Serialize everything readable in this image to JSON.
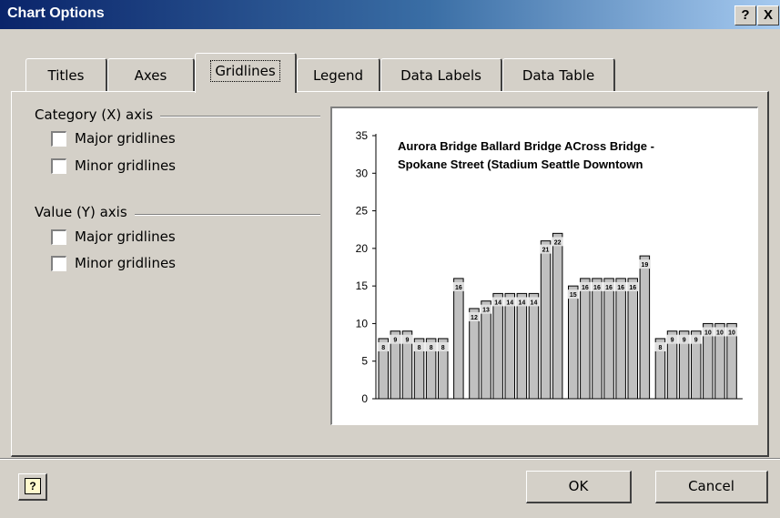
{
  "window": {
    "title": "Chart Options",
    "help_button": "?",
    "close_button": "X"
  },
  "tabs": [
    {
      "label": "Titles",
      "active": false
    },
    {
      "label": "Axes",
      "active": false
    },
    {
      "label": "Gridlines",
      "active": true
    },
    {
      "label": "Legend",
      "active": false
    },
    {
      "label": "Data Labels",
      "active": false
    },
    {
      "label": "Data Table",
      "active": false
    }
  ],
  "gridlines": {
    "category_group": {
      "title": "Category (X) axis",
      "major_label": "Major gridlines",
      "major_checked": false,
      "minor_label": "Minor gridlines",
      "minor_checked": false
    },
    "value_group": {
      "title": "Value (Y) axis",
      "major_label": "Major gridlines",
      "major_checked": false,
      "minor_label": "Minor gridlines",
      "minor_checked": false
    }
  },
  "buttons": {
    "ok": "OK",
    "cancel": "Cancel",
    "help_icon": "help-question-icon"
  },
  "chart_data": {
    "type": "bar",
    "title_lines": [
      "Aurora Bridge Ballard Bridge ACross Bridge -",
      "Spokane Street (Stadium Seattle Downtown"
    ],
    "ylim": [
      0,
      35
    ],
    "yticks": [
      0,
      5,
      10,
      15,
      20,
      25,
      30,
      35
    ],
    "grid": false,
    "bar_color": "#c0c0c0",
    "groups": [
      {
        "values": [
          8,
          9,
          9,
          8,
          8,
          8
        ]
      },
      {
        "values": [
          16
        ]
      },
      {
        "values": [
          12,
          13,
          14,
          14,
          14,
          14,
          21,
          22
        ]
      },
      {
        "values": [
          15,
          16,
          16,
          16,
          16,
          16,
          19
        ]
      },
      {
        "values": [
          8,
          9,
          9,
          9,
          10,
          10,
          10
        ]
      }
    ]
  }
}
